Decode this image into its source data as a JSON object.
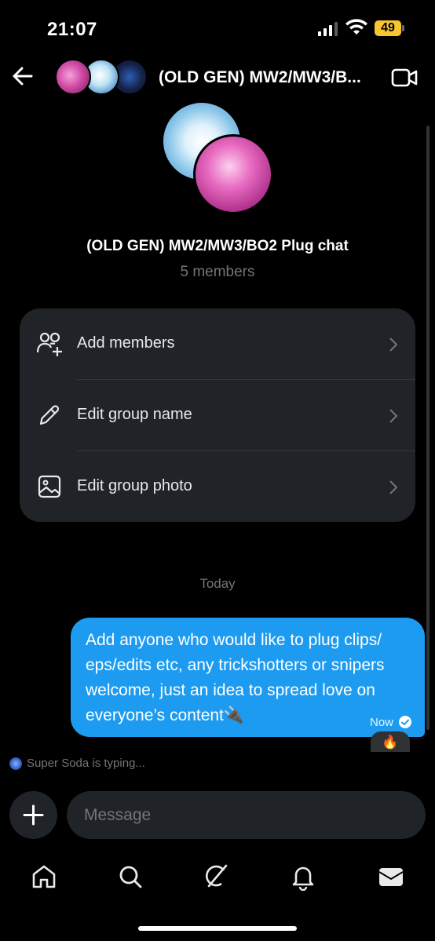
{
  "status_bar": {
    "time": "21:07",
    "battery": "49"
  },
  "header": {
    "title": "(OLD GEN) MW2/MW3/B..."
  },
  "group": {
    "name": "(OLD GEN) MW2/MW3/BO2 Plug chat",
    "members": "5 members"
  },
  "settings": [
    {
      "label": "Add members",
      "icon": "add-members-icon"
    },
    {
      "label": "Edit group name",
      "icon": "pencil-icon"
    },
    {
      "label": "Edit group photo",
      "icon": "image-icon"
    }
  ],
  "date_separator": "Today",
  "message": {
    "text": "Add anyone who would like to plug clips/ eps/edits etc, any trickshotters or snipers welcome, just an idea to spread love on everyone’s content🔌",
    "time": "Now",
    "reaction": "🔥"
  },
  "typing_indicator": "Super Soda is typing...",
  "composer": {
    "placeholder": "Message"
  },
  "nav": [
    "home-icon",
    "search-icon",
    "grok-icon",
    "notifications-icon",
    "messages-icon"
  ],
  "colors": {
    "accent": "#1d9bf0",
    "background": "#000000",
    "card": "#202327",
    "muted": "#71767b"
  }
}
